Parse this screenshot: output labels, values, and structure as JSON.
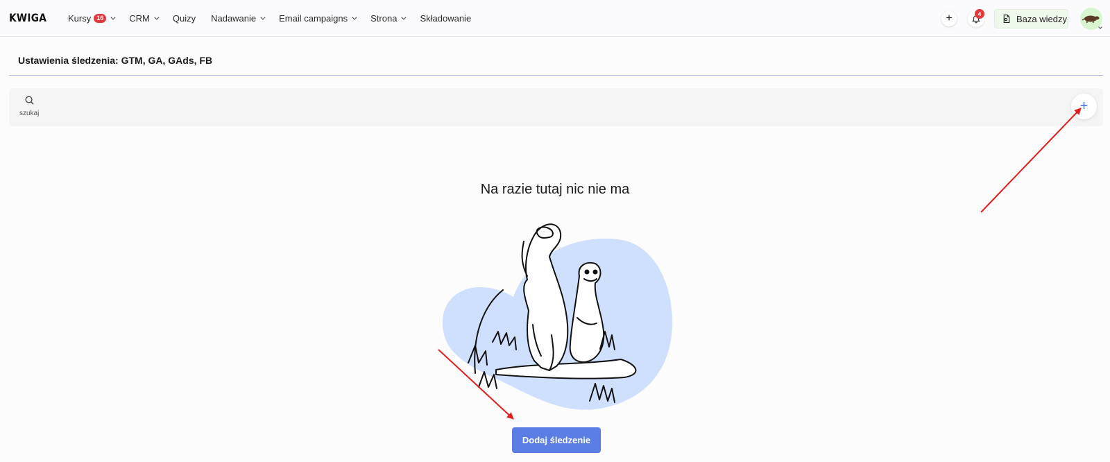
{
  "header": {
    "logo": "KWIGA",
    "nav": [
      {
        "label": "Kursy",
        "badge": "16",
        "has_dropdown": true
      },
      {
        "label": "CRM",
        "has_dropdown": true
      },
      {
        "label": "Quizy",
        "has_dropdown": false
      },
      {
        "label": "Nadawanie",
        "has_dropdown": true
      },
      {
        "label": "Email campaigns",
        "has_dropdown": true
      },
      {
        "label": "Strona",
        "has_dropdown": true
      },
      {
        "label": "Składowanie",
        "has_dropdown": false
      }
    ],
    "plus_label": "+",
    "notifications_count": "4",
    "knowledge_base_label": "Baza wiedzy"
  },
  "page": {
    "title": "Ustawienia śledzenia: GTM, GA, GAds, FB"
  },
  "search": {
    "label": "szukaj"
  },
  "toolbar": {
    "add_label": "+"
  },
  "empty_state": {
    "title": "Na razie tutaj nic nie ma",
    "button_label": "Dodaj śledzenie"
  },
  "colors": {
    "accent": "#5b7ee5",
    "blob": "#cfe0ff",
    "badge": "#e5383b",
    "annotation_arrow": "#e01e1e"
  }
}
